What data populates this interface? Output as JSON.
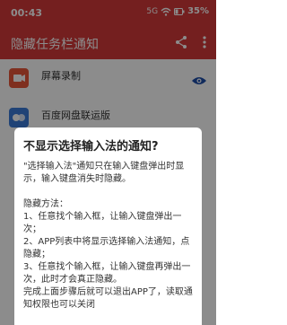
{
  "status_bar": {
    "time": "00:43",
    "signal_text": "5G",
    "battery": "35%"
  },
  "app_bar": {
    "title": "隐藏任务栏通知",
    "icons": [
      "share-icon",
      "more-vert-icon"
    ]
  },
  "list": {
    "items": [
      {
        "label": "屏幕录制",
        "icon": "screen-record-icon",
        "icon_color": "#e8563a"
      },
      {
        "label": "百度网盘联运版",
        "icon": "baidu-netdisk-icon",
        "icon_color": "#3b7bd8"
      }
    ]
  },
  "dialog": {
    "title": "不显示选择输入法的通知?",
    "para1": "\"选择输入法\"通知只在输入键盘弹出时显示，输入键盘消失时隐藏。",
    "para2_lines": [
      "隐藏方法：",
      "1、任意找个输入框，让输入键盘弹出一次；",
      "2、APP列表中将显示选择输入法通知，点隐藏；",
      "3、任意找个输入框，让输入键盘再弹出一次，此时才会真正隐藏。",
      "完成上面步骤后就可以退出APP了，读取通知权限也可以关闭"
    ]
  },
  "colors": {
    "primary": "#d33a3a",
    "eye": "#1e4ea8"
  }
}
